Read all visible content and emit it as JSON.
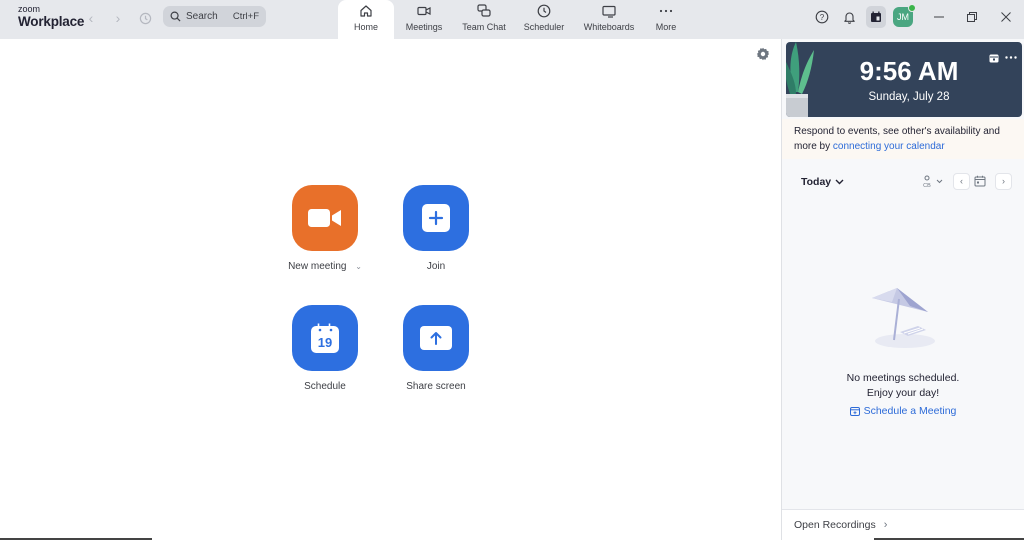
{
  "app": {
    "brand_small": "zoom",
    "brand_big": "Workplace"
  },
  "search": {
    "label": "Search",
    "shortcut": "Ctrl+F"
  },
  "tabs": [
    {
      "label": "Home",
      "icon": "home-icon",
      "active": true
    },
    {
      "label": "Meetings",
      "icon": "video-camera-icon",
      "active": false
    },
    {
      "label": "Team Chat",
      "icon": "chat-bubbles-icon",
      "active": false
    },
    {
      "label": "Scheduler",
      "icon": "clock-icon",
      "active": false
    },
    {
      "label": "Whiteboards",
      "icon": "whiteboard-icon",
      "active": false
    },
    {
      "label": "More",
      "icon": "ellipsis-icon",
      "active": false
    }
  ],
  "top_right": {
    "help": "help-icon",
    "notifications": "bell-icon",
    "apps": "calendar-app-icon",
    "avatar_initials": "JM",
    "presence_color": "#3bb54a"
  },
  "actions": [
    {
      "label": "New meeting",
      "icon": "video-camera-icon",
      "color": "#e8702a",
      "has_dropdown": true
    },
    {
      "label": "Join",
      "icon": "plus-icon",
      "color": "#2d6fe0",
      "has_dropdown": false
    },
    {
      "label": "Schedule",
      "icon": "calendar-icon",
      "calendar_day": "19",
      "color": "#2d6fe0",
      "has_dropdown": false
    },
    {
      "label": "Share screen",
      "icon": "upload-arrow-icon",
      "color": "#2d6fe0",
      "has_dropdown": false
    }
  ],
  "sidebar": {
    "clock": {
      "time": "9:56 AM",
      "date": "Sunday, July 28"
    },
    "connect_text": "Respond to events, see other's availability and more by ",
    "connect_link": "connecting your calendar",
    "day_selector": "Today",
    "empty_line1": "No meetings scheduled.",
    "empty_line2": "Enjoy your day!",
    "schedule_link": "Schedule a Meeting",
    "footer_label": "Open Recordings"
  }
}
